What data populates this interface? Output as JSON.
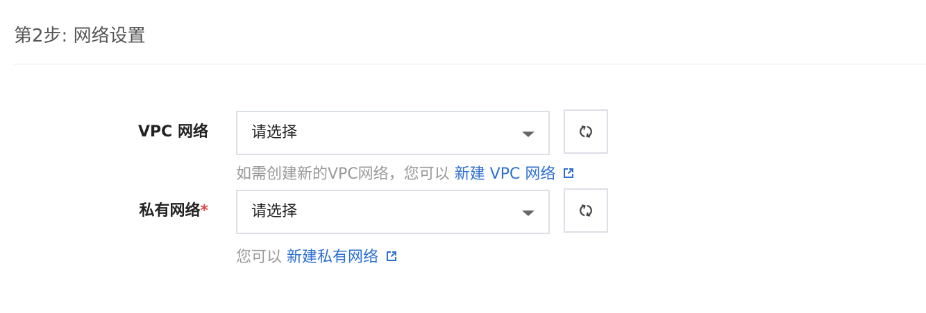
{
  "header": {
    "step_title": "第2步: 网络设置"
  },
  "form": {
    "vpc": {
      "label": "VPC 网络",
      "select_value": "请选择",
      "help_text": "如需创建新的VPC网络，您可以",
      "link_text": "新建 VPC 网络"
    },
    "subnet": {
      "label": "私有网络",
      "required_marker": "*",
      "select_value": "请选择",
      "help_text": "您可以",
      "link_text": "新建私有网络"
    }
  },
  "colors": {
    "link": "#2c6fd1",
    "required": "#e54545",
    "help_text": "#999999",
    "border": "#dcdfe6"
  },
  "icons": {
    "refresh": "refresh-icon",
    "dropdown": "chevron-down-icon",
    "external_link": "external-link-icon"
  }
}
